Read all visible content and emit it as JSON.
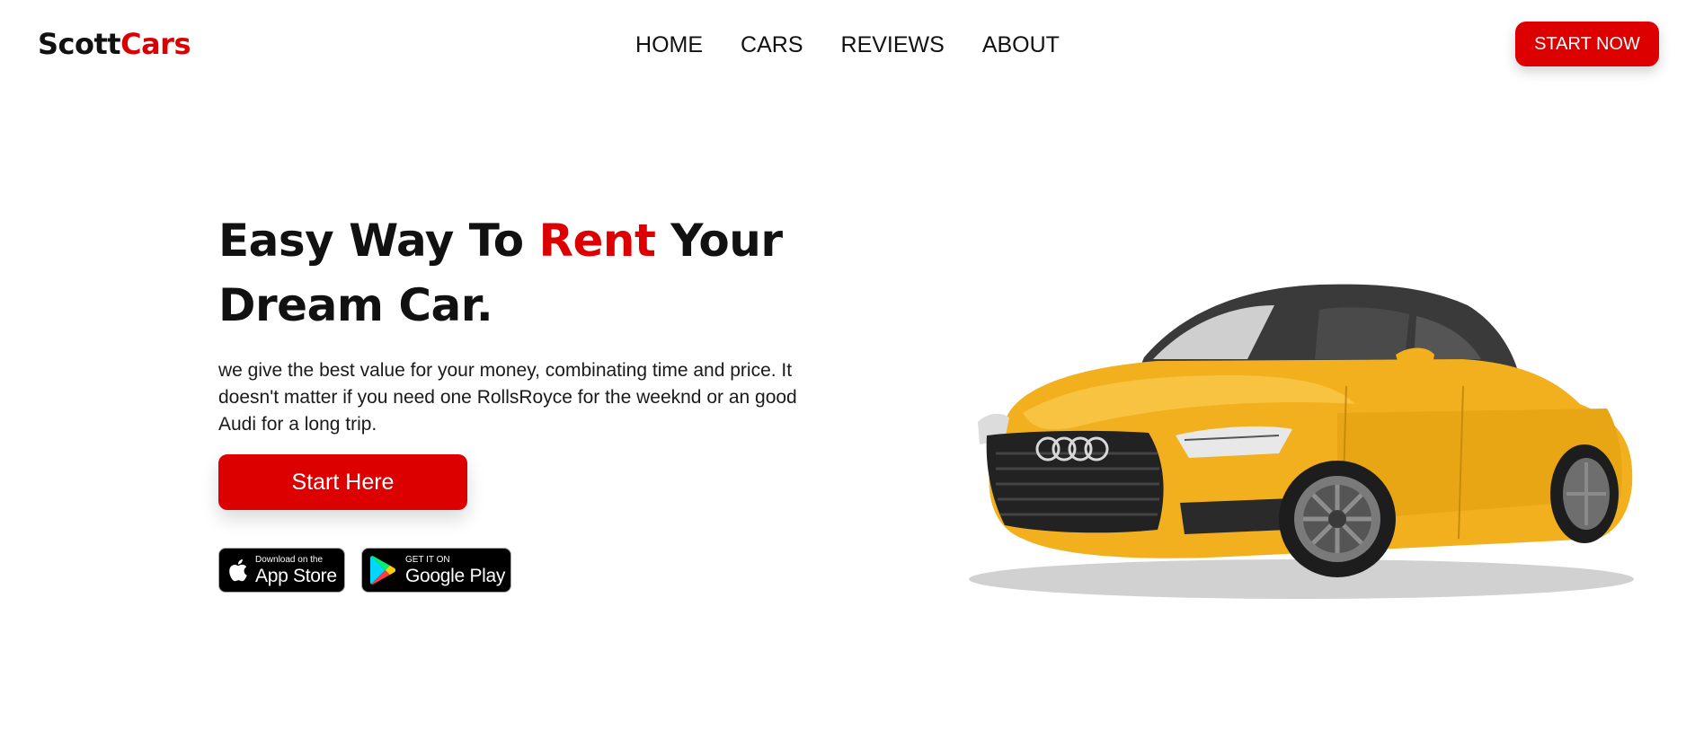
{
  "brand": {
    "logo_part1": "Scott",
    "logo_part2": "Cars",
    "accent_color": "#dc0000"
  },
  "nav": {
    "items": [
      {
        "label": "HOME"
      },
      {
        "label": "CARS"
      },
      {
        "label": "REVIEWS"
      },
      {
        "label": "ABOUT"
      }
    ]
  },
  "header": {
    "cta_label": "START NOW"
  },
  "hero": {
    "title_part1": "Easy Way To ",
    "title_accent": "Rent",
    "title_part2": " Your Dream Car.",
    "description": "we give the best value for your money, combinating time and price. It doesn't matter if you need one RollsRoyce for the weeknd or an good Audi for a long trip.",
    "cta_label": "Start Here"
  },
  "stores": {
    "apple_small": "Download on the",
    "apple_big": "App Store",
    "google_small": "GET IT ON",
    "google_big": "Google Play"
  },
  "car": {
    "body_color": "#f2b01e",
    "icon": "car-image"
  }
}
